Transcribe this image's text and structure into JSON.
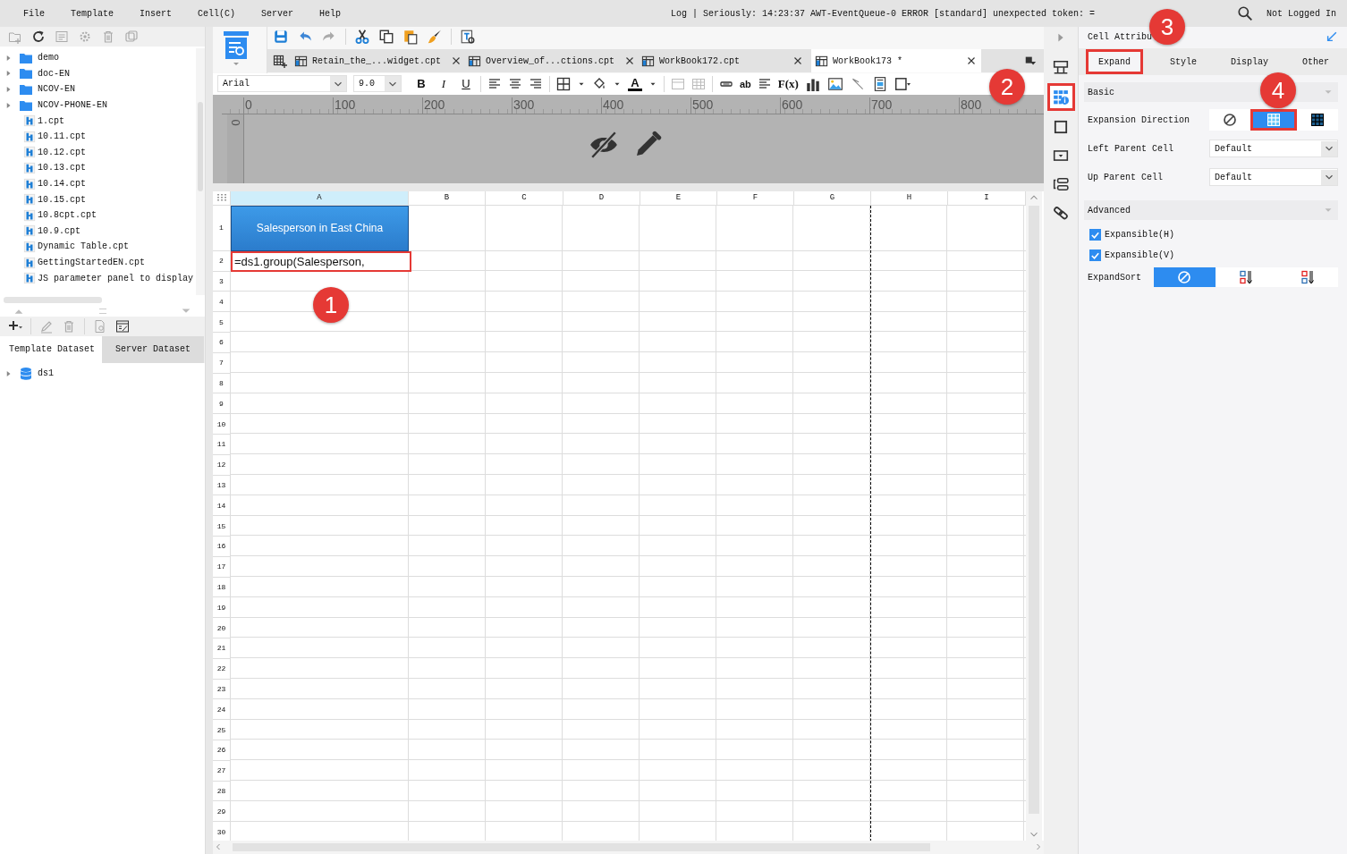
{
  "menu": [
    {
      "label": "File"
    },
    {
      "label": "Template"
    },
    {
      "label": "Insert"
    },
    {
      "label": "Cell(C)"
    },
    {
      "label": "Server"
    },
    {
      "label": "Help"
    }
  ],
  "log": "Log | Seriously: 14:23:37 AWT-EventQueue-0 ERROR [standard] unexpected token: =",
  "user": "Not Logged In",
  "tree": [
    {
      "label": "demo",
      "kind": "folder"
    },
    {
      "label": "doc-EN",
      "kind": "folder"
    },
    {
      "label": "NCOV-EN",
      "kind": "folder"
    },
    {
      "label": "NCOV-PHONE-EN",
      "kind": "folder"
    },
    {
      "label": "1.cpt",
      "kind": "file"
    },
    {
      "label": "10.11.cpt",
      "kind": "file"
    },
    {
      "label": "10.12.cpt",
      "kind": "file"
    },
    {
      "label": "10.13.cpt",
      "kind": "file"
    },
    {
      "label": "10.14.cpt",
      "kind": "file"
    },
    {
      "label": "10.15.cpt",
      "kind": "file"
    },
    {
      "label": "10.8cpt.cpt",
      "kind": "file"
    },
    {
      "label": "10.9.cpt",
      "kind": "file"
    },
    {
      "label": "Dynamic Table.cpt",
      "kind": "file"
    },
    {
      "label": "GettingStartedEN.cpt",
      "kind": "file"
    },
    {
      "label": "JS parameter panel to display",
      "kind": "file"
    }
  ],
  "dataset_tabs": [
    {
      "label": "Template Dataset",
      "selected": true
    },
    {
      "label": "Server Dataset",
      "selected": false
    }
  ],
  "datasets": [
    {
      "label": "ds1"
    }
  ],
  "file_tabs": [
    {
      "label": "Retain_the_...widget.cpt",
      "selected": false
    },
    {
      "label": "Overview_of...ctions.cpt",
      "selected": false
    },
    {
      "label": "WorkBook172.cpt",
      "selected": false
    },
    {
      "label": "WorkBook173 *",
      "selected": true
    }
  ],
  "format": {
    "font": "Arial",
    "size": "9.0",
    "style_buttons": [
      "B",
      "I",
      "U"
    ],
    "font_color": "A",
    "text_buttons": [
      "ab",
      "F(x)"
    ]
  },
  "ruler": {
    "marks": [
      "0",
      "100",
      "200",
      "300",
      "400",
      "500",
      "600",
      "700",
      "800"
    ],
    "vertical": "0"
  },
  "sheet": {
    "columns": [
      "A",
      "B",
      "C",
      "D",
      "E",
      "F",
      "G",
      "H",
      "I"
    ],
    "rows": [
      "1",
      "2",
      "3",
      "4",
      "5",
      "6",
      "7",
      "8",
      "9",
      "10",
      "11",
      "12",
      "13",
      "14",
      "15",
      "16",
      "17",
      "18",
      "19",
      "20",
      "21",
      "22",
      "23",
      "24",
      "25",
      "26",
      "27",
      "28",
      "29",
      "30"
    ],
    "column_a": [
      {
        "text": "Salesperson in East China",
        "kind": "header",
        "highlighted": false
      },
      {
        "text": "=ds1.group(Salesperson,",
        "kind": "editing",
        "highlighted": true
      }
    ]
  },
  "side_icons": [
    {
      "selected": false,
      "highlighted": false
    },
    {
      "selected": true,
      "highlighted": true
    },
    {
      "selected": false,
      "highlighted": false
    },
    {
      "selected": false,
      "highlighted": false
    },
    {
      "selected": false,
      "highlighted": false
    },
    {
      "selected": false,
      "highlighted": false
    }
  ],
  "panel": {
    "title": "Cell Attribu",
    "tabs": [
      {
        "label": "Expand",
        "selected": true,
        "highlighted": true
      },
      {
        "label": "Style",
        "selected": false,
        "highlighted": false
      },
      {
        "label": "Display",
        "selected": false,
        "highlighted": false
      },
      {
        "label": "Other",
        "selected": false,
        "highlighted": false
      }
    ],
    "basic": "Basic",
    "direction": {
      "label": "Expansion Direction",
      "options": [
        {
          "selected": false,
          "highlighted": false
        },
        {
          "selected": true,
          "highlighted": true
        },
        {
          "selected": false,
          "highlighted": false
        }
      ]
    },
    "left_parent": {
      "label": "Left Parent Cell",
      "value": "Default"
    },
    "up_parent": {
      "label": "Up Parent Cell",
      "value": "Default"
    },
    "advanced": "Advanced",
    "checks": [
      {
        "label": "Expansible(H)",
        "checked": true
      },
      {
        "label": "Expansible(V)",
        "checked": true
      }
    ],
    "sort": {
      "label": "ExpandSort",
      "options": [
        {
          "selected": true
        },
        {
          "selected": false
        },
        {
          "selected": false
        }
      ]
    }
  },
  "callouts": [
    "1",
    "2",
    "3",
    "4"
  ]
}
